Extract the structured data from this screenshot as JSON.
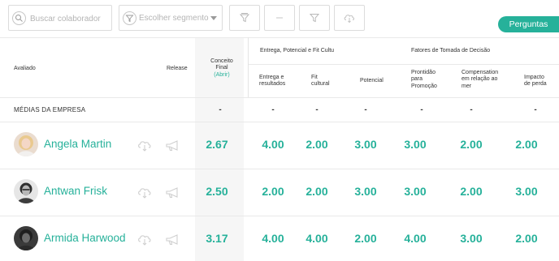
{
  "toolbar": {
    "search_placeholder": "Buscar colaborador",
    "segment_placeholder": "Escolher segmento",
    "perguntas_label": "Perguntas"
  },
  "table": {
    "headers": {
      "avaliado": "Avaliado",
      "release": "Release",
      "conceito_final_line1": "Conceito",
      "conceito_final_line2": "Final",
      "abrir": "(Abrir)",
      "group1": "Entrega, Potencial e Fit Cultu",
      "group2": "Fatores de Tomada de Decisão",
      "entrega_l1": "Entrega e",
      "entrega_l2": "resultados",
      "fit_l1": "Fit",
      "fit_l2": "cultural",
      "potencial": "Potencial",
      "prontidao_l1": "Prontidão",
      "prontidao_l2": "para",
      "prontidao_l3": "Promoção",
      "comp_l1": "Compensation",
      "comp_l2": "em relação ao",
      "comp_l3": "mer",
      "impacto_l1": "Impacto",
      "impacto_l2": "de perda"
    },
    "company_average": {
      "label": "MÉDIAS DA EMPRESA",
      "values": [
        "-",
        "-",
        "-",
        "-",
        "-",
        "-",
        "-"
      ]
    },
    "rows": [
      {
        "name": "Angela Martin",
        "final": "2.67",
        "scores": [
          "4.00",
          "2.00",
          "3.00",
          "3.00",
          "2.00",
          "2.00"
        ]
      },
      {
        "name": "Antwan Frisk",
        "final": "2.50",
        "scores": [
          "2.00",
          "2.00",
          "3.00",
          "3.00",
          "2.00",
          "3.00"
        ]
      },
      {
        "name": "Armida Harwood",
        "final": "3.17",
        "scores": [
          "4.00",
          "4.00",
          "2.00",
          "4.00",
          "3.00",
          "2.00"
        ]
      }
    ]
  },
  "colors": {
    "accent": "#26b19a",
    "final_column_bg": "#f6f6f6",
    "border": "#dcdcdc"
  },
  "icons": {
    "search": "search-icon",
    "segment": "segment-filter-icon",
    "tool_buttons": [
      "filter-clear-icon",
      "minus-icon",
      "funnel-icon",
      "cloud-download-icon"
    ],
    "row_actions": [
      "cloud-download-icon",
      "megaphone-icon"
    ]
  }
}
